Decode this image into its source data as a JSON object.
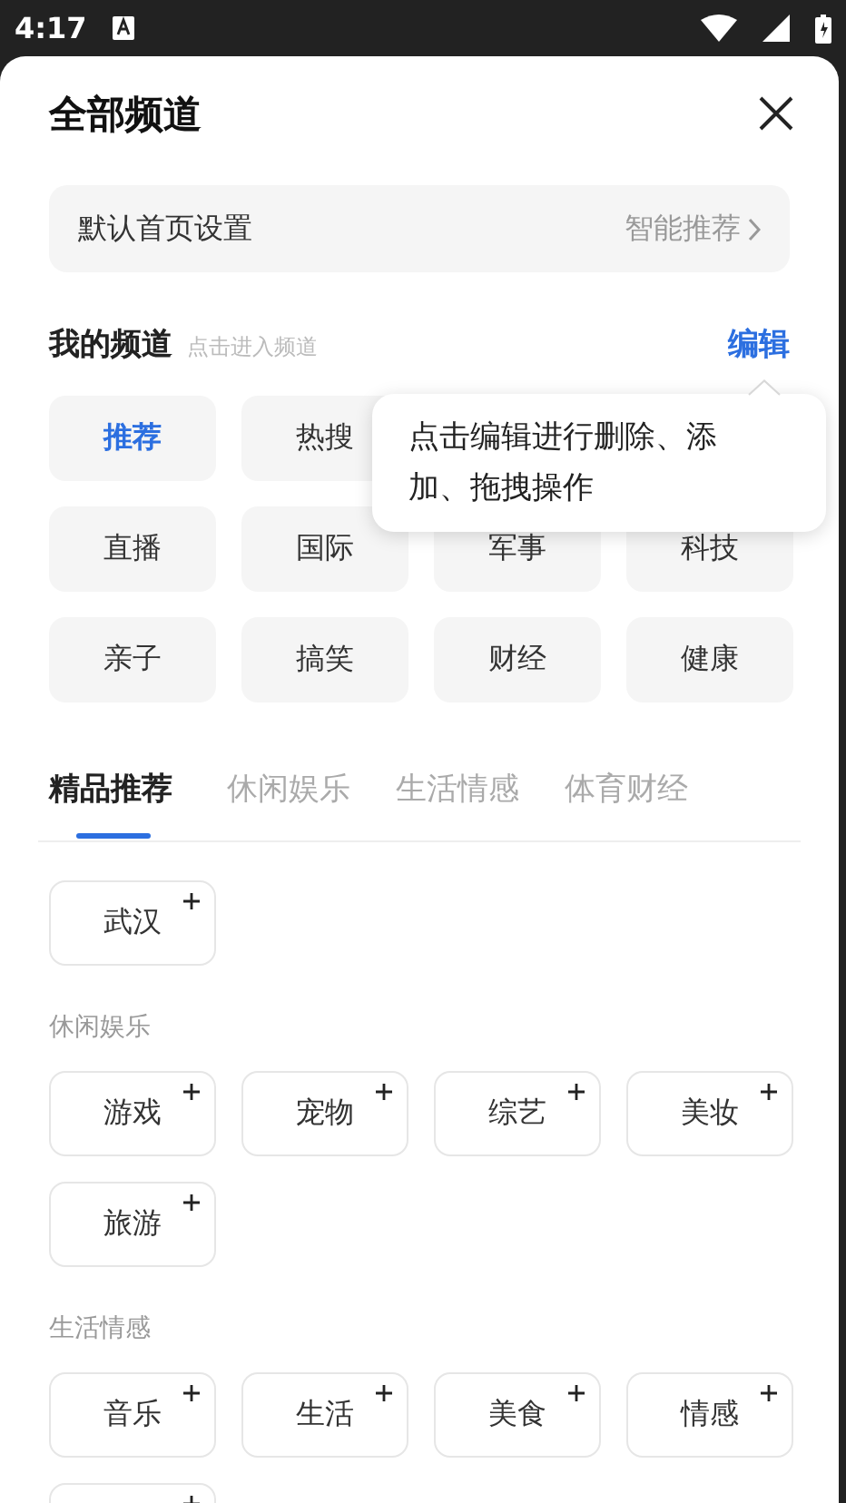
{
  "status_bar": {
    "time": "4:17"
  },
  "header": {
    "title": "全部频道"
  },
  "default_home": {
    "label": "默认首页设置",
    "value": "智能推荐"
  },
  "my_channels": {
    "title": "我的频道",
    "hint": "点击进入频道",
    "edit": "编辑",
    "rows": [
      [
        {
          "label": "推荐",
          "selected": true
        },
        {
          "label": "热搜",
          "selected": false
        }
      ],
      [
        {
          "label": "直播",
          "selected": false
        },
        {
          "label": "国际",
          "selected": false
        },
        {
          "label": "军事",
          "selected": false
        },
        {
          "label": "科技",
          "selected": false
        }
      ],
      [
        {
          "label": "亲子",
          "selected": false
        },
        {
          "label": "搞笑",
          "selected": false
        },
        {
          "label": "财经",
          "selected": false
        },
        {
          "label": "健康",
          "selected": false
        }
      ]
    ]
  },
  "tooltip": "点击编辑进行删除、添加、拖拽操作",
  "tabs": [
    {
      "label": "精品推荐",
      "selected": true
    },
    {
      "label": "休闲娱乐",
      "selected": false
    },
    {
      "label": "生活情感",
      "selected": false
    },
    {
      "label": "体育财经",
      "selected": false
    }
  ],
  "sections": [
    {
      "items": [
        "武汉"
      ]
    },
    {
      "title": "休闲娱乐",
      "items": [
        "游戏",
        "宠物",
        "综艺",
        "美妆",
        "旅游"
      ]
    },
    {
      "title": "生活情感",
      "items": [
        "音乐",
        "生活",
        "美食",
        "情感"
      ],
      "cut_off_chip": true
    }
  ]
}
